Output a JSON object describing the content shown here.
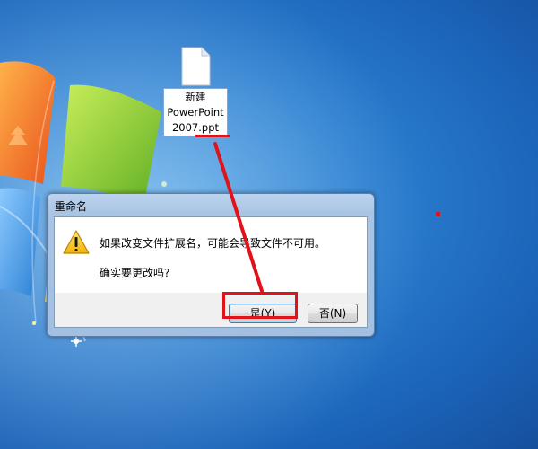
{
  "desktop": {
    "file": {
      "label_lines": [
        "新建",
        "PowerPoint",
        "2007.ppt"
      ],
      "icon": "document-icon"
    }
  },
  "dialog": {
    "title": "重命名",
    "icon": "warning-icon",
    "message": "如果改变文件扩展名，可能会导致文件不可用。",
    "question": "确实要更改吗?",
    "yes_label": "是(Y)",
    "no_label": "否(N)"
  },
  "annotation": {
    "color": "#e0121a"
  }
}
